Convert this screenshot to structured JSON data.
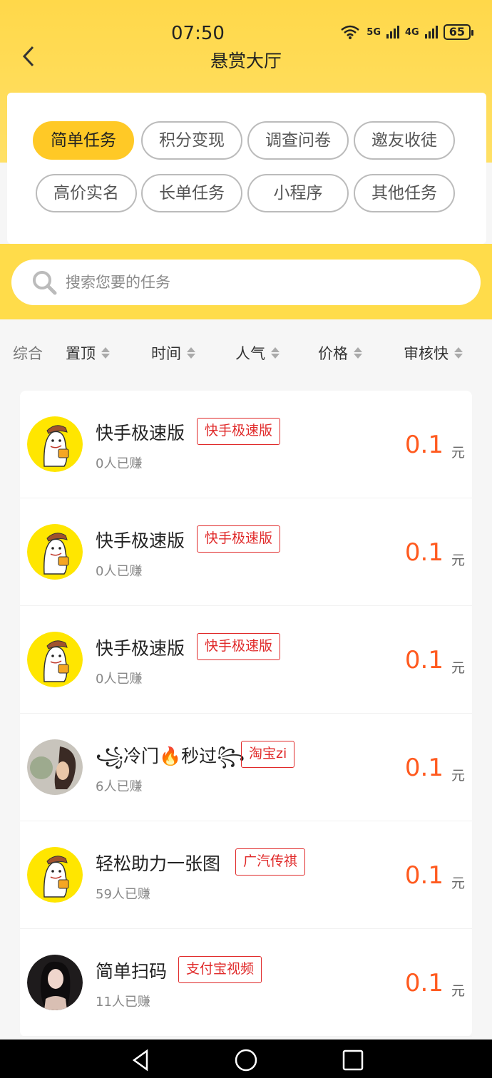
{
  "status": {
    "time": "07:50",
    "wifi_label": "6",
    "sim1": "5G",
    "sim2": "4G",
    "battery": "65"
  },
  "header": {
    "title": "悬赏大厅",
    "back_icon": "chevron-left-icon"
  },
  "categories": [
    "简单任务",
    "积分变现",
    "调查问卷",
    "邀友收徒",
    "高价实名",
    "长单任务",
    "小程序",
    "其他任务"
  ],
  "active_category": "简单任务",
  "search": {
    "placeholder": "搜索您要的任务"
  },
  "sort": [
    "综合",
    "置顶",
    "时间",
    "人气",
    "价格",
    "审核快"
  ],
  "tasks": [
    {
      "name": "快手极速版",
      "tag": "快手极速版",
      "earned": "0人已赚",
      "price": "0.1",
      "unit": "元",
      "avatar": "mascot"
    },
    {
      "name": "快手极速版",
      "tag": "快手极速版",
      "earned": "0人已赚",
      "price": "0.1",
      "unit": "元",
      "avatar": "mascot"
    },
    {
      "name": "快手极速版",
      "tag": "快手极速版",
      "earned": "0人已赚",
      "price": "0.1",
      "unit": "元",
      "avatar": "mascot"
    },
    {
      "name": "꧁冷门🔥秒过꧂",
      "tag": "淘宝zi",
      "earned": "6人已赚",
      "price": "0.1",
      "unit": "元",
      "avatar": "photo-woman-side"
    },
    {
      "name": "轻松助力一张图",
      "tag": "广汽传祺",
      "earned": "59人已赚",
      "price": "0.1",
      "unit": "元",
      "avatar": "mascot"
    },
    {
      "name": "简单扫码",
      "tag": "支付宝视频",
      "earned": "11人已赚",
      "price": "0.1",
      "unit": "元",
      "avatar": "photo-woman-dark"
    }
  ],
  "colors": {
    "accent": "#ffd84a",
    "price": "#ff5a1f",
    "tag": "#e02a2a"
  }
}
